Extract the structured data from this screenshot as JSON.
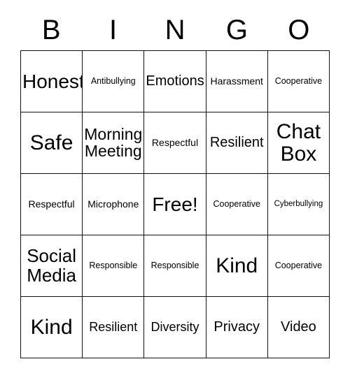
{
  "card": {
    "title_letters": [
      "B",
      "I",
      "N",
      "G",
      "O"
    ],
    "grid": {
      "columns": 5,
      "rows": 5,
      "border_color": "#111111",
      "background_color": "#ffffff",
      "text_color": "#000000",
      "cells": [
        [
          {
            "text": "Honest",
            "size": "xl"
          },
          {
            "text": "Antibullying",
            "size": "xxs"
          },
          {
            "text": "Emotions",
            "size": "md"
          },
          {
            "text": "Harassment",
            "size": "xs"
          },
          {
            "text": "Cooperative",
            "size": "xxs"
          }
        ],
        [
          {
            "text": "Safe",
            "size": "xxl"
          },
          {
            "text": "Morning\nMeeting",
            "size": "ml"
          },
          {
            "text": "Respectful",
            "size": "xs"
          },
          {
            "text": "Resilient",
            "size": "md"
          },
          {
            "text": "Chat\nBox",
            "size": "xxl"
          }
        ],
        [
          {
            "text": "Respectful",
            "size": "xs"
          },
          {
            "text": "Microphone",
            "size": "xs"
          },
          {
            "text": "Free!",
            "size": "xl"
          },
          {
            "text": "Cooperative",
            "size": "xxs"
          },
          {
            "text": "Cyberbullying",
            "size": "tin"
          }
        ],
        [
          {
            "text": "Social\nMedia",
            "size": "lg"
          },
          {
            "text": "Responsible",
            "size": "xxs"
          },
          {
            "text": "Responsible",
            "size": "xxs"
          },
          {
            "text": "Kind",
            "size": "xxl"
          },
          {
            "text": "Cooperative",
            "size": "xxs"
          }
        ],
        [
          {
            "text": "Kind",
            "size": "xxl"
          },
          {
            "text": "Resilient",
            "size": "sm"
          },
          {
            "text": "Diversity",
            "size": "sm"
          },
          {
            "text": "Privacy",
            "size": "md"
          },
          {
            "text": "Video",
            "size": "md"
          }
        ]
      ]
    }
  }
}
